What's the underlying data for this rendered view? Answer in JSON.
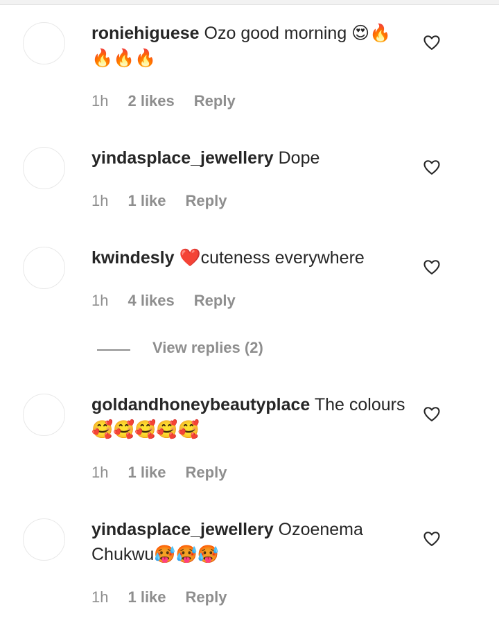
{
  "comments": [
    {
      "username": "roniehiguese",
      "text": "Ozo good morning 😍🔥🔥🔥🔥",
      "time": "1h",
      "likes": "2 likes",
      "reply": "Reply"
    },
    {
      "username": "yindasplace_jewellery",
      "text": "Dope",
      "time": "1h",
      "likes": "1 like",
      "reply": "Reply"
    },
    {
      "username": "kwindesly",
      "text": "❤️cuteness everywhere",
      "time": "1h",
      "likes": "4 likes",
      "reply": "Reply"
    },
    {
      "username": "goldandhoneybeautyplace",
      "text": "The colours🥰🥰🥰🥰🥰",
      "time": "1h",
      "likes": "1 like",
      "reply": "Reply"
    },
    {
      "username": "yindasplace_jewellery",
      "text": "Ozoenema Chukwu🥵🥵🥵",
      "time": "1h",
      "likes": "1 like",
      "reply": "Reply"
    }
  ],
  "view_replies": "View replies (2)",
  "icons": {
    "like": "heart-outline-icon",
    "avatar": "profile-avatar"
  },
  "colors": {
    "text": "#262626",
    "meta": "#8e8e8e",
    "background": "#ffffff"
  }
}
